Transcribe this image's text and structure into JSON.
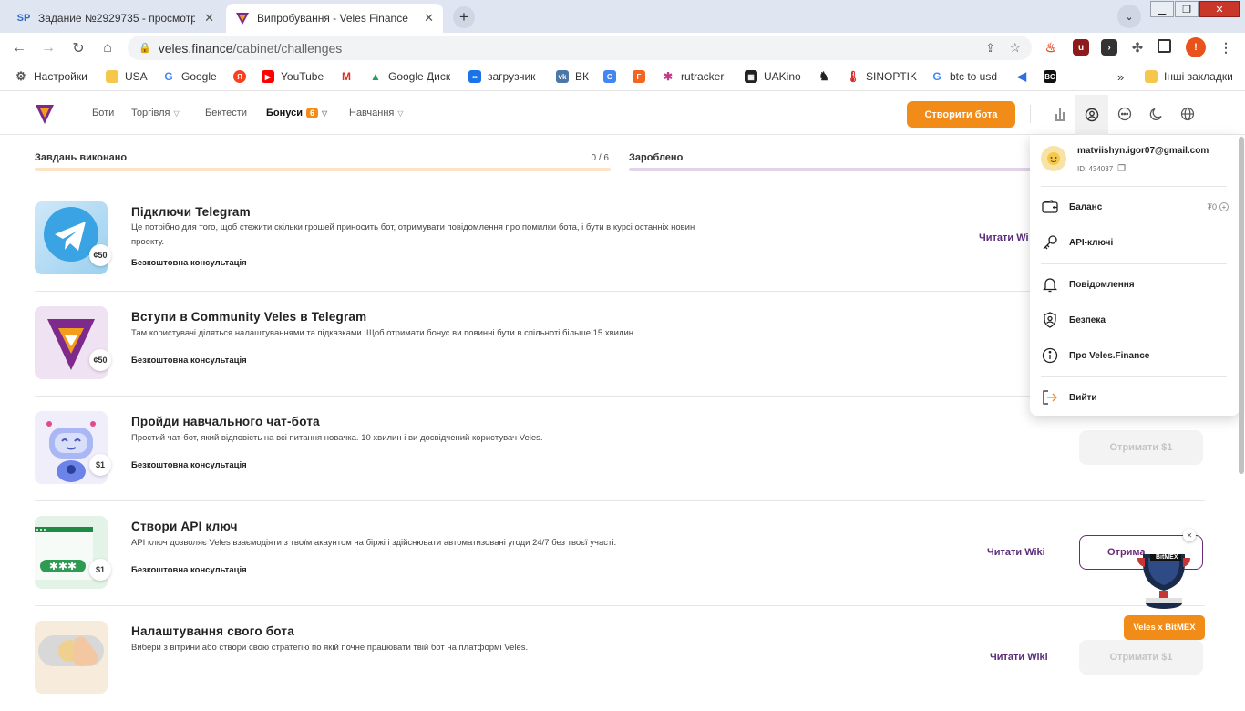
{
  "browser": {
    "tabs": [
      {
        "title": "Задание №2929735 - просмотр",
        "favicon": "SP"
      },
      {
        "title": "Випробування - Veles Finance"
      }
    ],
    "url_host": "veles.finance",
    "url_path": "/cabinet/challenges",
    "bookmarks": [
      {
        "label": "Настройки",
        "icon": "gear-icon"
      },
      {
        "label": "USA",
        "icon": "folder-icon"
      },
      {
        "label": "Google",
        "icon": "google-icon"
      },
      {
        "label": "",
        "icon": "yandex-icon"
      },
      {
        "label": "YouTube",
        "icon": "youtube-icon"
      },
      {
        "label": "",
        "icon": "gmail-icon"
      },
      {
        "label": "Google Диск",
        "icon": "drive-icon"
      },
      {
        "label": "загрузчик",
        "icon": "infinity-icon"
      },
      {
        "label": "ВК",
        "icon": "vk-icon"
      },
      {
        "label": "",
        "icon": "translate-icon"
      },
      {
        "label": "",
        "icon": "f-icon"
      },
      {
        "label": "rutracker",
        "icon": "rutracker-icon"
      },
      {
        "label": "UAKino",
        "icon": "uakino-icon"
      },
      {
        "label": "",
        "icon": "chess-icon"
      },
      {
        "label": "SINOPTIK",
        "icon": "thermometer-icon"
      },
      {
        "label": "btc to usd",
        "icon": "google-icon"
      },
      {
        "label": "",
        "icon": "kyber-icon"
      },
      {
        "label": "",
        "icon": "bc-icon"
      }
    ],
    "bc_label": "BC",
    "other_bookmarks": "Інші закладки",
    "profile_initial": "!"
  },
  "header": {
    "nav": [
      {
        "label": "Боти"
      },
      {
        "label": "Торгівля"
      },
      {
        "label": "Бектести"
      },
      {
        "label": "Бонуси",
        "badge": "6"
      },
      {
        "label": "Навчання"
      }
    ],
    "create_bot": "Створити бота"
  },
  "progress": {
    "tasks_label": "Завдань виконано",
    "tasks_count": "0 / 6",
    "tasks_done": 0,
    "tasks_total": 6,
    "earned_label": "Зароблено"
  },
  "challenges": [
    {
      "title": "Підключи Telegram",
      "description": "Це потрібно для того, щоб стежити скільки грошей приносить бот, отримувати повідомлення про помилки бота, і бути в курсі останніх новин проекту.",
      "consultation": "Безкоштовна консультація",
      "reward": "¢50",
      "wiki": "Читати Wi",
      "thumb": "telegram"
    },
    {
      "title": "Вступи в Community Veles в Telegram",
      "description": "Там користувачі діляться налаштуваннями та підказками. Щоб отримати бонус ви повинні бути в спільноті більше 15 хвилин.",
      "consultation": "Безкоштовна консультація",
      "reward": "¢50",
      "thumb": "veles-logo"
    },
    {
      "title": "Пройди навчального чат-бота",
      "description": "Простий чат-бот, який відповість на всі питання новачка. 10 хвилин і ви досвідчений користувач Veles.",
      "consultation": "Безкоштовна консультація",
      "reward": "$1",
      "button": "Отримати $1",
      "thumb": "robot"
    },
    {
      "title": "Створи API ключ",
      "description": "API ключ дозволяє Veles взаємодіяти з твоїм акаунтом на біржі і здійснювати автоматизовані угоди 24/7 без твоєї участі.",
      "consultation": "Безкоштовна консультація",
      "reward": "$1",
      "wiki": "Читати Wiki",
      "button": "Отрима",
      "thumb": "api-key"
    },
    {
      "title": "Налаштування свого бота",
      "description": "Вибери з вітрини або створи свою стратегію по якій почне працювати твій бот на платформі Veles.",
      "wiki": "Читати Wiki",
      "button": "Отримати $1",
      "thumb": "toggle-hand"
    }
  ],
  "account_menu": {
    "email": "matviishyn.igor07@gmail.com",
    "id": "ID: 434037",
    "balance_label": "Баланс",
    "balance_value": "₮0",
    "api_keys": "API-ключі",
    "notifications": "Повідомлення",
    "security": "Безпека",
    "about": "Про Veles.Finance",
    "logout": "Вийти"
  },
  "promo": {
    "badge_text": "BitMEX",
    "button": "Veles x BitMEX"
  },
  "colors": {
    "brand_orange": "#f28c18",
    "brand_purple": "#6a2a75",
    "tasks_track": "#fbe3c6",
    "earned_track": "#e3d3e8"
  }
}
